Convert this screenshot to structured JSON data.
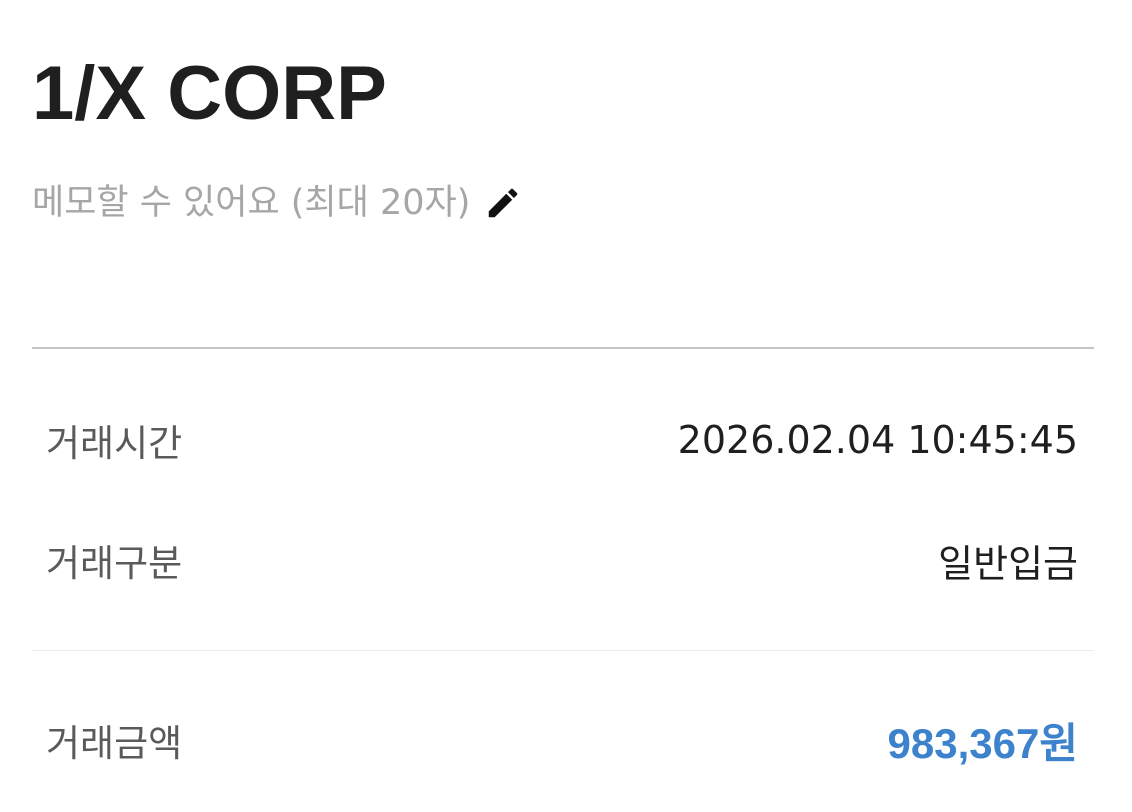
{
  "header": {
    "title": "1/X CORP"
  },
  "memo": {
    "placeholder": "메모할 수 있어요 (최대 20자)",
    "icon": "pencil-icon"
  },
  "details": {
    "time": {
      "label": "거래시간",
      "value": "2026.02.04 10:45:45"
    },
    "type": {
      "label": "거래구분",
      "value": "일반입금"
    },
    "amount": {
      "label": "거래금액",
      "value": "983,367원"
    }
  },
  "colors": {
    "amount": "#3d82cc",
    "memo_placeholder": "#a6a6a6",
    "label": "#5a5a5a"
  }
}
